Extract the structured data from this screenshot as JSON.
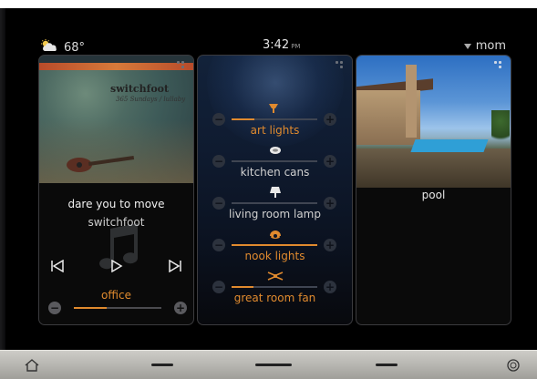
{
  "status": {
    "temperature": "68°",
    "time": "3:42",
    "ampm": "PM",
    "user": "mom"
  },
  "music": {
    "album_brand": "switchfoot",
    "album_subtitle": "365 Sundays / lullaby",
    "song": "dare you to move",
    "artist": "switchfoot",
    "zone": "office",
    "volume_fraction": 0.38
  },
  "lights": [
    {
      "label": "art lights",
      "state": "on",
      "level": 0.27,
      "icon": "spotlight-icon"
    },
    {
      "label": "kitchen cans",
      "state": "off",
      "level": 0,
      "icon": "can-light-icon"
    },
    {
      "label": "living room lamp",
      "state": "off",
      "level": 0,
      "icon": "lamp-icon"
    },
    {
      "label": "nook lights",
      "state": "on",
      "level": 1.0,
      "icon": "pendant-icon"
    },
    {
      "label": "great room fan",
      "state": "on",
      "level": 0.26,
      "icon": "fan-icon"
    }
  ],
  "pool": {
    "label": "pool"
  },
  "colors": {
    "accent": "#e08a2e"
  }
}
